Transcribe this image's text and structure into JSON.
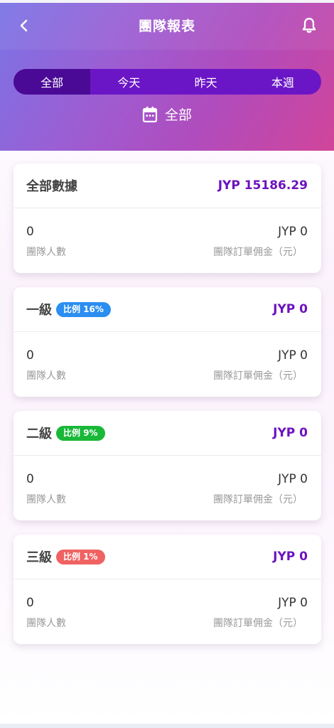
{
  "header": {
    "title": "團隊報表"
  },
  "tabs": [
    {
      "label": "全部",
      "active": true
    },
    {
      "label": "今天",
      "active": false
    },
    {
      "label": "昨天",
      "active": false
    },
    {
      "label": "本週",
      "active": false
    }
  ],
  "date_filter": {
    "label": "全部",
    "icon": "calendar-icon"
  },
  "colors": {
    "accent": "#6c12bf",
    "level1_badge": "#2b8ef0",
    "level2_badge": "#19b838",
    "level3_badge": "#f06262"
  },
  "cards": [
    {
      "title": "全部數據",
      "badge": "",
      "amount": "JYP 15186.29",
      "members_value": "0",
      "members_label": "團隊人數",
      "commission_value": "JYP 0",
      "commission_label": "團隊訂單佣金（元）"
    },
    {
      "title": "一級",
      "badge": "比例 16%",
      "amount": "JYP 0",
      "members_value": "0",
      "members_label": "團隊人數",
      "commission_value": "JYP 0",
      "commission_label": "團隊訂單佣金（元）"
    },
    {
      "title": "二級",
      "badge": "比例 9%",
      "amount": "JYP 0",
      "members_value": "0",
      "members_label": "團隊人數",
      "commission_value": "JYP 0",
      "commission_label": "團隊訂單佣金（元）"
    },
    {
      "title": "三級",
      "badge": "比例 1%",
      "amount": "JYP 0",
      "members_value": "0",
      "members_label": "團隊人數",
      "commission_value": "JYP 0",
      "commission_label": "團隊訂單佣金（元）"
    }
  ]
}
